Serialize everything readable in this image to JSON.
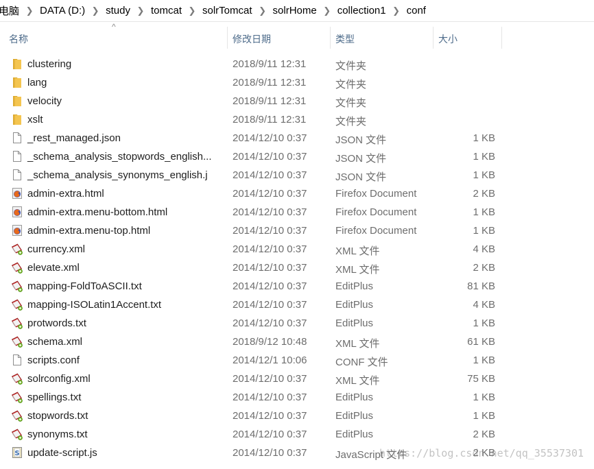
{
  "breadcrumb": [
    "电脑",
    "DATA (D:)",
    "study",
    "tomcat",
    "solrTomcat",
    "solrHome",
    "collection1",
    "conf"
  ],
  "columns": {
    "name": "名称",
    "date": "修改日期",
    "type": "类型",
    "size": "大小"
  },
  "sort_indicator": "^",
  "files": [
    {
      "name": "clustering",
      "date": "2018/9/11 12:31",
      "type": "文件夹",
      "size": "",
      "icon": "folder-icon"
    },
    {
      "name": "lang",
      "date": "2018/9/11 12:31",
      "type": "文件夹",
      "size": "",
      "icon": "folder-icon"
    },
    {
      "name": "velocity",
      "date": "2018/9/11 12:31",
      "type": "文件夹",
      "size": "",
      "icon": "folder-icon"
    },
    {
      "name": "xslt",
      "date": "2018/9/11 12:31",
      "type": "文件夹",
      "size": "",
      "icon": "folder-icon"
    },
    {
      "name": "_rest_managed.json",
      "date": "2014/12/10 0:37",
      "type": "JSON 文件",
      "size": "1 KB",
      "icon": "document-icon"
    },
    {
      "name": "_schema_analysis_stopwords_english...",
      "date": "2014/12/10 0:37",
      "type": "JSON 文件",
      "size": "1 KB",
      "icon": "document-icon"
    },
    {
      "name": "_schema_analysis_synonyms_english.j",
      "date": "2014/12/10 0:37",
      "type": "JSON 文件",
      "size": "1 KB",
      "icon": "document-icon"
    },
    {
      "name": "admin-extra.html",
      "date": "2014/12/10 0:37",
      "type": "Firefox Document",
      "size": "2 KB",
      "icon": "firefox-document-icon"
    },
    {
      "name": "admin-extra.menu-bottom.html",
      "date": "2014/12/10 0:37",
      "type": "Firefox Document",
      "size": "1 KB",
      "icon": "firefox-document-icon"
    },
    {
      "name": "admin-extra.menu-top.html",
      "date": "2014/12/10 0:37",
      "type": "Firefox Document",
      "size": "1 KB",
      "icon": "firefox-document-icon"
    },
    {
      "name": "currency.xml",
      "date": "2014/12/10 0:37",
      "type": "XML 文件",
      "size": "4 KB",
      "icon": "editplus-icon"
    },
    {
      "name": "elevate.xml",
      "date": "2014/12/10 0:37",
      "type": "XML 文件",
      "size": "2 KB",
      "icon": "editplus-icon"
    },
    {
      "name": "mapping-FoldToASCII.txt",
      "date": "2014/12/10 0:37",
      "type": "EditPlus",
      "size": "81 KB",
      "icon": "editplus-icon"
    },
    {
      "name": "mapping-ISOLatin1Accent.txt",
      "date": "2014/12/10 0:37",
      "type": "EditPlus",
      "size": "4 KB",
      "icon": "editplus-icon"
    },
    {
      "name": "protwords.txt",
      "date": "2014/12/10 0:37",
      "type": "EditPlus",
      "size": "1 KB",
      "icon": "editplus-icon"
    },
    {
      "name": "schema.xml",
      "date": "2018/9/12 10:48",
      "type": "XML 文件",
      "size": "61 KB",
      "icon": "editplus-icon"
    },
    {
      "name": "scripts.conf",
      "date": "2014/12/1 10:06",
      "type": "CONF 文件",
      "size": "1 KB",
      "icon": "document-icon"
    },
    {
      "name": "solrconfig.xml",
      "date": "2014/12/10 0:37",
      "type": "XML 文件",
      "size": "75 KB",
      "icon": "editplus-icon"
    },
    {
      "name": "spellings.txt",
      "date": "2014/12/10 0:37",
      "type": "EditPlus",
      "size": "1 KB",
      "icon": "editplus-icon"
    },
    {
      "name": "stopwords.txt",
      "date": "2014/12/10 0:37",
      "type": "EditPlus",
      "size": "1 KB",
      "icon": "editplus-icon"
    },
    {
      "name": "synonyms.txt",
      "date": "2014/12/10 0:37",
      "type": "EditPlus",
      "size": "2 KB",
      "icon": "editplus-icon"
    },
    {
      "name": "update-script.js",
      "date": "2014/12/10 0:37",
      "type": "JavaScript 文件",
      "size": "2 KB",
      "icon": "javascript-file-icon"
    }
  ],
  "watermark": "https://blog.csdn.net/qq_35537301",
  "colors": {
    "header_text": "#4d6b8a",
    "secondary_text": "#6d6d6d",
    "folder": "#f4c550"
  }
}
